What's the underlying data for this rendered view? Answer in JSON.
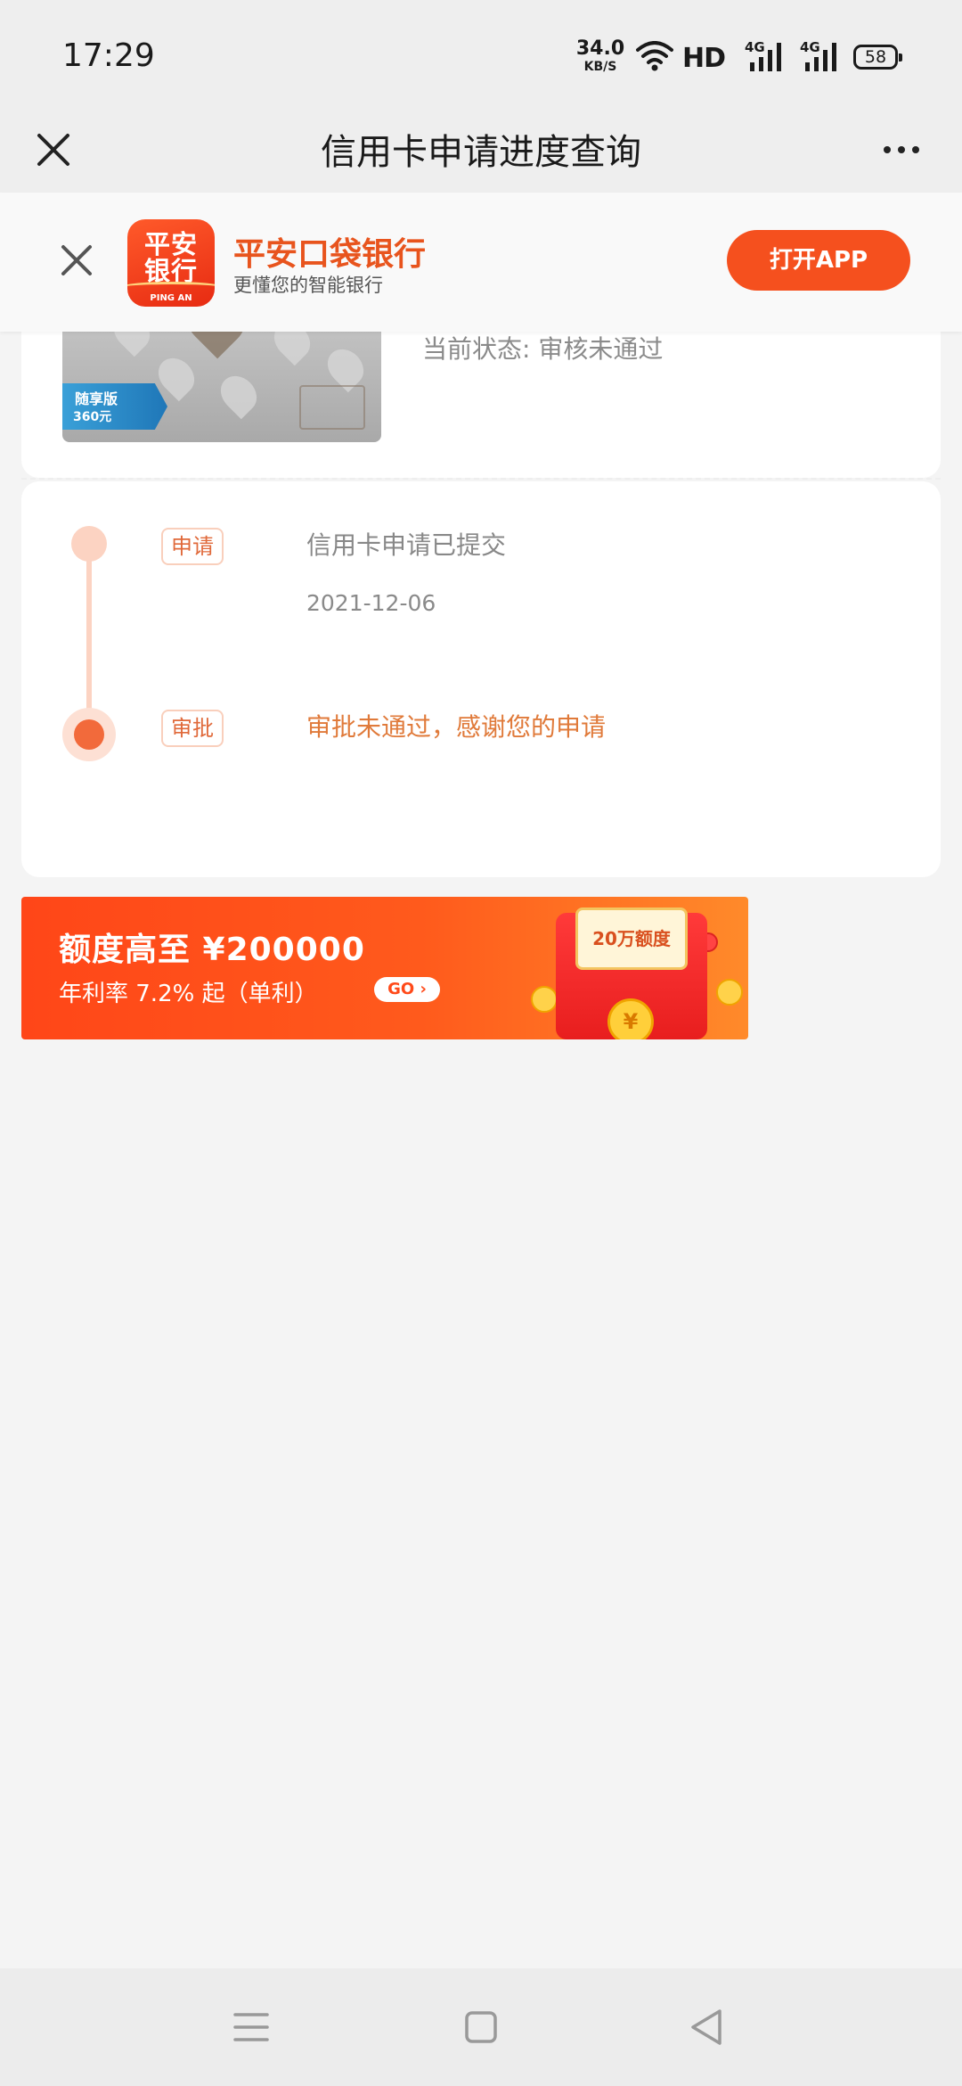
{
  "status_bar": {
    "time": "17:29",
    "net_speed_value": "34.0",
    "net_speed_unit": "KB/S",
    "hd_label": "HD",
    "net1": "4G",
    "net2": "4G",
    "battery": "58"
  },
  "title_bar": {
    "title": "信用卡申请进度查询",
    "close_icon": "close-icon",
    "more_icon": "more-icon"
  },
  "app_banner": {
    "logo_line1": "平安",
    "logo_line2": "银行",
    "logo_line3": "PING AN",
    "app_name": "平安口袋银行",
    "slogan": "更懂您的智能银行",
    "open_button": "打开APP",
    "brand_color": "#f5501e"
  },
  "card_summary": {
    "card_badge_title": "随享版",
    "card_badge_subtitle": "360元",
    "status_text": "当前状态: 审核未通过"
  },
  "timeline": {
    "steps": [
      {
        "tag": "申请",
        "text": "信用卡申请已提交",
        "date": "2021-12-06"
      },
      {
        "tag": "审批",
        "text": "审批未通过，感谢您的申请"
      }
    ],
    "accent_color": "#f26a3b"
  },
  "promo": {
    "title": "额度高至 ¥200000",
    "subtitle": "年利率 7.2% 起（单利）",
    "go_label": "GO ›",
    "envelope_label": "20万额度",
    "coin_symbol": "¥"
  },
  "nav_bar": {
    "icons": [
      "menu-icon",
      "home-icon",
      "back-icon"
    ]
  }
}
